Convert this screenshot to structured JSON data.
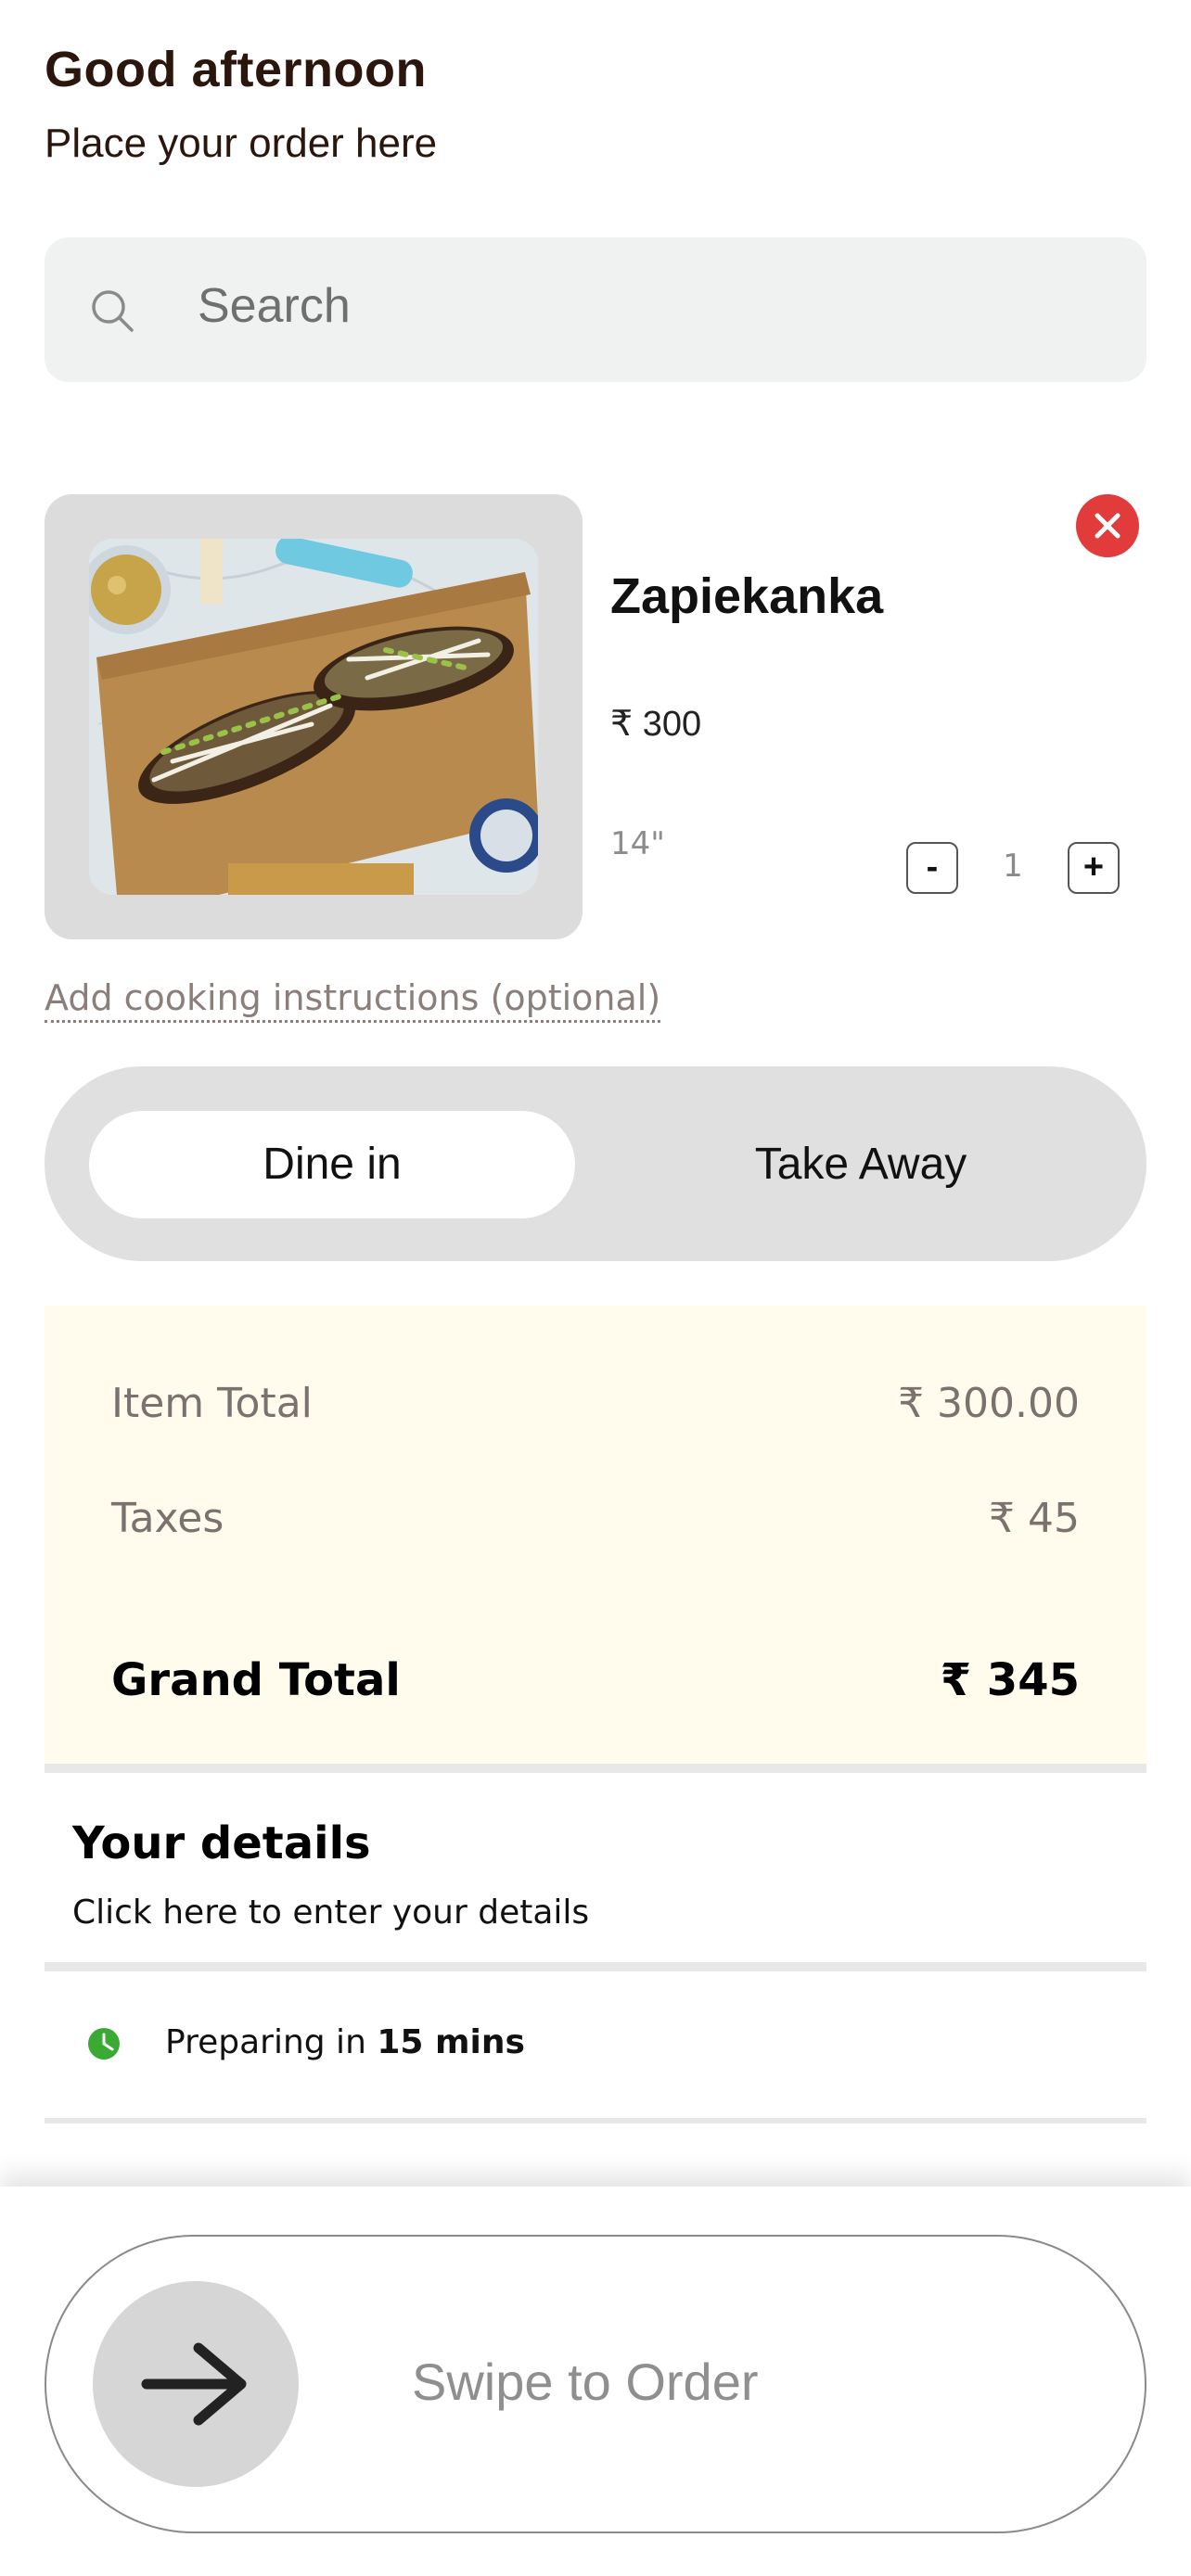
{
  "header": {
    "greeting": "Good afternoon",
    "subtitle": "Place your order here"
  },
  "search": {
    "placeholder": "Search",
    "icon": "search-icon"
  },
  "cart_item": {
    "name": "Zapiekanka",
    "price": "₹ 300",
    "size": "14\"",
    "quantity": "1",
    "minus_label": "-",
    "plus_label": "+",
    "photo": "zapiekanka-photo",
    "remove_icon": "close-icon"
  },
  "cooking_instructions_label": "Add cooking instructions (optional)",
  "order_type": {
    "options": [
      "Dine in",
      "Take Away"
    ],
    "selected": "Dine in"
  },
  "bill": {
    "item_total_label": "Item Total",
    "item_total_value": "₹ 300.00",
    "taxes_label": "Taxes",
    "taxes_value": "₹ 45",
    "grand_total_label": "Grand Total",
    "grand_total_value": "₹ 345",
    "background": "#fffcee"
  },
  "details": {
    "title": "Your details",
    "hint": "Click here to enter your details"
  },
  "prep": {
    "prefix": "Preparing in",
    "time": "15 mins",
    "icon": "clock-icon",
    "icon_color": "#3aaa35"
  },
  "swipe": {
    "label": "Swipe to Order",
    "icon": "arrow-right-icon"
  },
  "colors": {
    "remove": "#e23b3b",
    "heading": "#2a160c"
  }
}
